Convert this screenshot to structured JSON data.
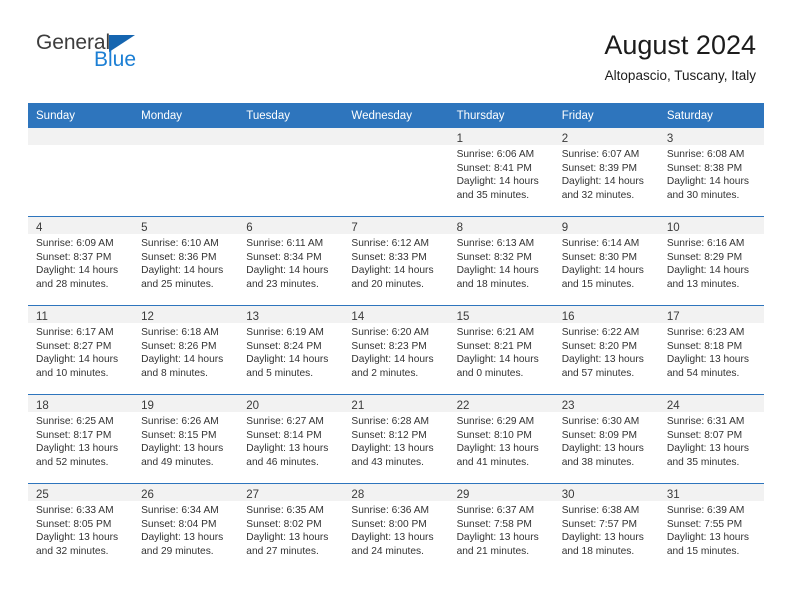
{
  "brand": {
    "name_part1": "General",
    "name_part2": "Blue",
    "logo_icon": "triangle-flag-icon"
  },
  "header": {
    "title": "August 2024",
    "location": "Altopascio, Tuscany, Italy"
  },
  "colors": {
    "header_blue": "#2e75bd",
    "brand_blue": "#1c7fd4",
    "daynum_band": "#f2f2f2",
    "text": "#333333"
  },
  "weekday_headers": [
    "Sunday",
    "Monday",
    "Tuesday",
    "Wednesday",
    "Thursday",
    "Friday",
    "Saturday"
  ],
  "weeks": [
    [
      {
        "day": "",
        "empty": true
      },
      {
        "day": "",
        "empty": true
      },
      {
        "day": "",
        "empty": true
      },
      {
        "day": "",
        "empty": true
      },
      {
        "day": "1",
        "sunrise": "Sunrise: 6:06 AM",
        "sunset": "Sunset: 8:41 PM",
        "daylight": "Daylight: 14 hours and 35 minutes."
      },
      {
        "day": "2",
        "sunrise": "Sunrise: 6:07 AM",
        "sunset": "Sunset: 8:39 PM",
        "daylight": "Daylight: 14 hours and 32 minutes."
      },
      {
        "day": "3",
        "sunrise": "Sunrise: 6:08 AM",
        "sunset": "Sunset: 8:38 PM",
        "daylight": "Daylight: 14 hours and 30 minutes."
      }
    ],
    [
      {
        "day": "4",
        "sunrise": "Sunrise: 6:09 AM",
        "sunset": "Sunset: 8:37 PM",
        "daylight": "Daylight: 14 hours and 28 minutes."
      },
      {
        "day": "5",
        "sunrise": "Sunrise: 6:10 AM",
        "sunset": "Sunset: 8:36 PM",
        "daylight": "Daylight: 14 hours and 25 minutes."
      },
      {
        "day": "6",
        "sunrise": "Sunrise: 6:11 AM",
        "sunset": "Sunset: 8:34 PM",
        "daylight": "Daylight: 14 hours and 23 minutes."
      },
      {
        "day": "7",
        "sunrise": "Sunrise: 6:12 AM",
        "sunset": "Sunset: 8:33 PM",
        "daylight": "Daylight: 14 hours and 20 minutes."
      },
      {
        "day": "8",
        "sunrise": "Sunrise: 6:13 AM",
        "sunset": "Sunset: 8:32 PM",
        "daylight": "Daylight: 14 hours and 18 minutes."
      },
      {
        "day": "9",
        "sunrise": "Sunrise: 6:14 AM",
        "sunset": "Sunset: 8:30 PM",
        "daylight": "Daylight: 14 hours and 15 minutes."
      },
      {
        "day": "10",
        "sunrise": "Sunrise: 6:16 AM",
        "sunset": "Sunset: 8:29 PM",
        "daylight": "Daylight: 14 hours and 13 minutes."
      }
    ],
    [
      {
        "day": "11",
        "sunrise": "Sunrise: 6:17 AM",
        "sunset": "Sunset: 8:27 PM",
        "daylight": "Daylight: 14 hours and 10 minutes."
      },
      {
        "day": "12",
        "sunrise": "Sunrise: 6:18 AM",
        "sunset": "Sunset: 8:26 PM",
        "daylight": "Daylight: 14 hours and 8 minutes."
      },
      {
        "day": "13",
        "sunrise": "Sunrise: 6:19 AM",
        "sunset": "Sunset: 8:24 PM",
        "daylight": "Daylight: 14 hours and 5 minutes."
      },
      {
        "day": "14",
        "sunrise": "Sunrise: 6:20 AM",
        "sunset": "Sunset: 8:23 PM",
        "daylight": "Daylight: 14 hours and 2 minutes."
      },
      {
        "day": "15",
        "sunrise": "Sunrise: 6:21 AM",
        "sunset": "Sunset: 8:21 PM",
        "daylight": "Daylight: 14 hours and 0 minutes."
      },
      {
        "day": "16",
        "sunrise": "Sunrise: 6:22 AM",
        "sunset": "Sunset: 8:20 PM",
        "daylight": "Daylight: 13 hours and 57 minutes."
      },
      {
        "day": "17",
        "sunrise": "Sunrise: 6:23 AM",
        "sunset": "Sunset: 8:18 PM",
        "daylight": "Daylight: 13 hours and 54 minutes."
      }
    ],
    [
      {
        "day": "18",
        "sunrise": "Sunrise: 6:25 AM",
        "sunset": "Sunset: 8:17 PM",
        "daylight": "Daylight: 13 hours and 52 minutes."
      },
      {
        "day": "19",
        "sunrise": "Sunrise: 6:26 AM",
        "sunset": "Sunset: 8:15 PM",
        "daylight": "Daylight: 13 hours and 49 minutes."
      },
      {
        "day": "20",
        "sunrise": "Sunrise: 6:27 AM",
        "sunset": "Sunset: 8:14 PM",
        "daylight": "Daylight: 13 hours and 46 minutes."
      },
      {
        "day": "21",
        "sunrise": "Sunrise: 6:28 AM",
        "sunset": "Sunset: 8:12 PM",
        "daylight": "Daylight: 13 hours and 43 minutes."
      },
      {
        "day": "22",
        "sunrise": "Sunrise: 6:29 AM",
        "sunset": "Sunset: 8:10 PM",
        "daylight": "Daylight: 13 hours and 41 minutes."
      },
      {
        "day": "23",
        "sunrise": "Sunrise: 6:30 AM",
        "sunset": "Sunset: 8:09 PM",
        "daylight": "Daylight: 13 hours and 38 minutes."
      },
      {
        "day": "24",
        "sunrise": "Sunrise: 6:31 AM",
        "sunset": "Sunset: 8:07 PM",
        "daylight": "Daylight: 13 hours and 35 minutes."
      }
    ],
    [
      {
        "day": "25",
        "sunrise": "Sunrise: 6:33 AM",
        "sunset": "Sunset: 8:05 PM",
        "daylight": "Daylight: 13 hours and 32 minutes."
      },
      {
        "day": "26",
        "sunrise": "Sunrise: 6:34 AM",
        "sunset": "Sunset: 8:04 PM",
        "daylight": "Daylight: 13 hours and 29 minutes."
      },
      {
        "day": "27",
        "sunrise": "Sunrise: 6:35 AM",
        "sunset": "Sunset: 8:02 PM",
        "daylight": "Daylight: 13 hours and 27 minutes."
      },
      {
        "day": "28",
        "sunrise": "Sunrise: 6:36 AM",
        "sunset": "Sunset: 8:00 PM",
        "daylight": "Daylight: 13 hours and 24 minutes."
      },
      {
        "day": "29",
        "sunrise": "Sunrise: 6:37 AM",
        "sunset": "Sunset: 7:58 PM",
        "daylight": "Daylight: 13 hours and 21 minutes."
      },
      {
        "day": "30",
        "sunrise": "Sunrise: 6:38 AM",
        "sunset": "Sunset: 7:57 PM",
        "daylight": "Daylight: 13 hours and 18 minutes."
      },
      {
        "day": "31",
        "sunrise": "Sunrise: 6:39 AM",
        "sunset": "Sunset: 7:55 PM",
        "daylight": "Daylight: 13 hours and 15 minutes."
      }
    ]
  ]
}
